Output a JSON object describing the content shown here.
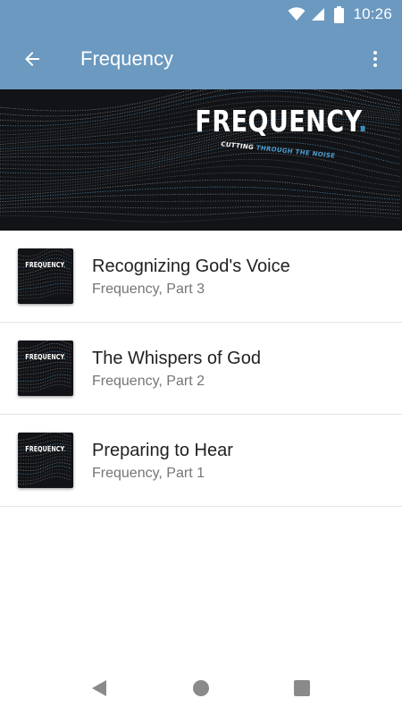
{
  "status_bar": {
    "time": "10:26",
    "icons": [
      "wifi-icon",
      "cell-signal-icon",
      "battery-icon"
    ]
  },
  "app_bar": {
    "title": "Frequency",
    "back_icon": "arrow-back-icon",
    "menu_icon": "more-vert-icon",
    "color": "#6b99c0"
  },
  "banner": {
    "title": "FREQUENCY",
    "title_dot": ".",
    "tagline_prefix": "CUTTING ",
    "tagline_highlight": "THROUGH THE NOISE",
    "accent_color": "#3a8fbf"
  },
  "episodes": [
    {
      "title": "Recognizing God's Voice",
      "subtitle": "Frequency, Part 3",
      "thumb_label": "FREQUENCY"
    },
    {
      "title": "The Whispers of God",
      "subtitle": "Frequency, Part 2",
      "thumb_label": "FREQUENCY"
    },
    {
      "title": "Preparing to Hear",
      "subtitle": "Frequency, Part 1",
      "thumb_label": "FREQUENCY"
    }
  ],
  "nav_bar": {
    "icons": [
      "nav-back-icon",
      "nav-home-icon",
      "nav-recents-icon"
    ]
  }
}
